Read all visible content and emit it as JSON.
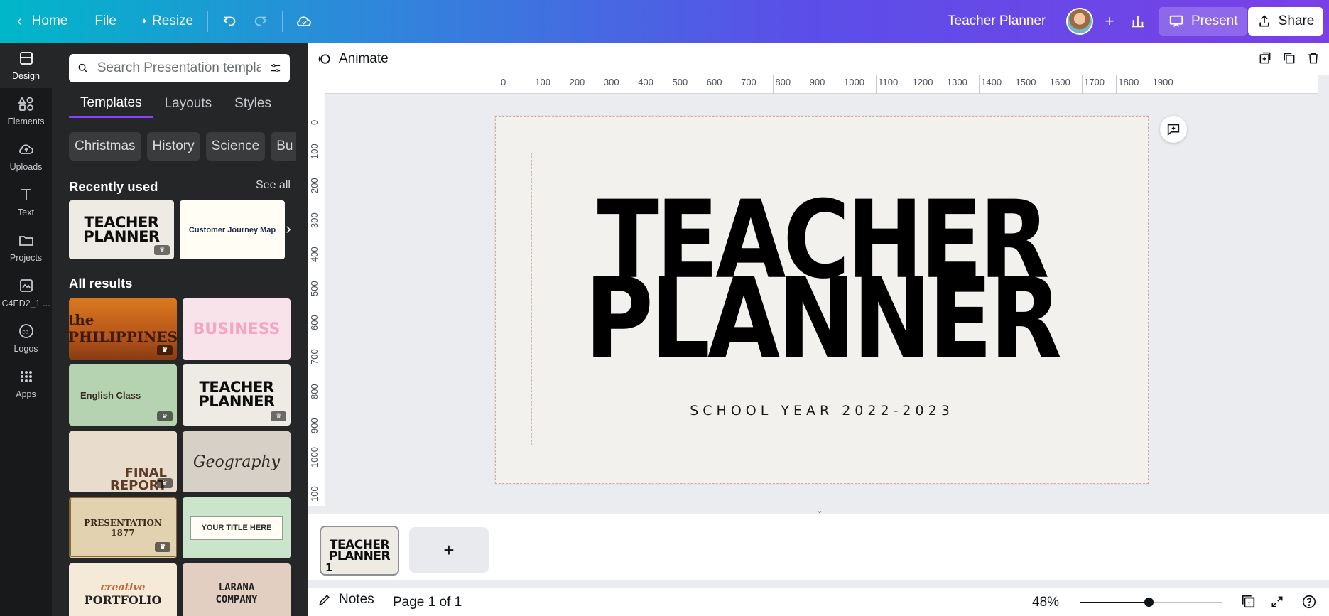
{
  "topbar": {
    "home": "Home",
    "file": "File",
    "resize": "Resize",
    "doc_title": "Teacher Planner",
    "present": "Present",
    "share": "Share"
  },
  "rail": {
    "items": [
      {
        "label": "Design",
        "icon": "design-icon"
      },
      {
        "label": "Elements",
        "icon": "elements-icon"
      },
      {
        "label": "Uploads",
        "icon": "uploads-icon"
      },
      {
        "label": "Text",
        "icon": "text-icon"
      },
      {
        "label": "Projects",
        "icon": "projects-icon"
      },
      {
        "label": "C4ED2_1 ...",
        "icon": "brand-kit-icon"
      },
      {
        "label": "Logos",
        "icon": "logos-icon"
      },
      {
        "label": "Apps",
        "icon": "apps-icon"
      }
    ]
  },
  "panel": {
    "search_placeholder": "Search Presentation templa",
    "tabs": [
      "Templates",
      "Layouts",
      "Styles"
    ],
    "chips": [
      "Christmas",
      "History",
      "Science",
      "Bu"
    ],
    "recently_used": "Recently used",
    "see_all": "See all",
    "all_results": "All results",
    "recent_thumbs": [
      {
        "line1": "TEACHER",
        "line2": "PLANNER"
      },
      {
        "title": "Customer Journey Map"
      }
    ],
    "result_thumbs": [
      {
        "text": "the PHILIPPINES"
      },
      {
        "text": "BUSINESS"
      },
      {
        "text": "English Class"
      },
      {
        "line1": "TEACHER",
        "line2": "PLANNER"
      },
      {
        "line1": "FINAL",
        "line2": "REPORT"
      },
      {
        "text": "Geography"
      },
      {
        "line1": "PRESENTATION",
        "line2": "1877"
      },
      {
        "text": "YOUR TITLE HERE"
      },
      {
        "line1": "creative",
        "line2": "PORTFOLIO"
      },
      {
        "line1": "LARANA",
        "line2": "COMPANY"
      }
    ]
  },
  "editor": {
    "animate": "Animate",
    "ruler_h": [
      "0",
      "100",
      "200",
      "300",
      "400",
      "500",
      "600",
      "700",
      "800",
      "900",
      "1000",
      "1100",
      "1200",
      "1300",
      "1400",
      "1500",
      "1600",
      "1700",
      "1800",
      "1900"
    ],
    "ruler_v": [
      "0",
      "100",
      "200",
      "300",
      "400",
      "500",
      "600",
      "700",
      "800",
      "900",
      "1000",
      "100"
    ],
    "slide": {
      "title_line1": "TEACHER",
      "title_line2": "PLANNER",
      "subtitle": "SCHOOL YEAR 2022-2023"
    }
  },
  "pages": {
    "page_number": "1",
    "thumb_line1": "TEACHER",
    "thumb_line2": "PLANNER"
  },
  "footer": {
    "notes": "Notes",
    "page_info": "Page 1 of 1",
    "zoom": "48%",
    "zoom_level": 0.48,
    "page_count_badge": "1"
  },
  "colors": {
    "accent": "#8b3dff",
    "panel_bg": "#252627",
    "rail_bg": "#18191b",
    "slide_bg": "#f3f1ed"
  }
}
